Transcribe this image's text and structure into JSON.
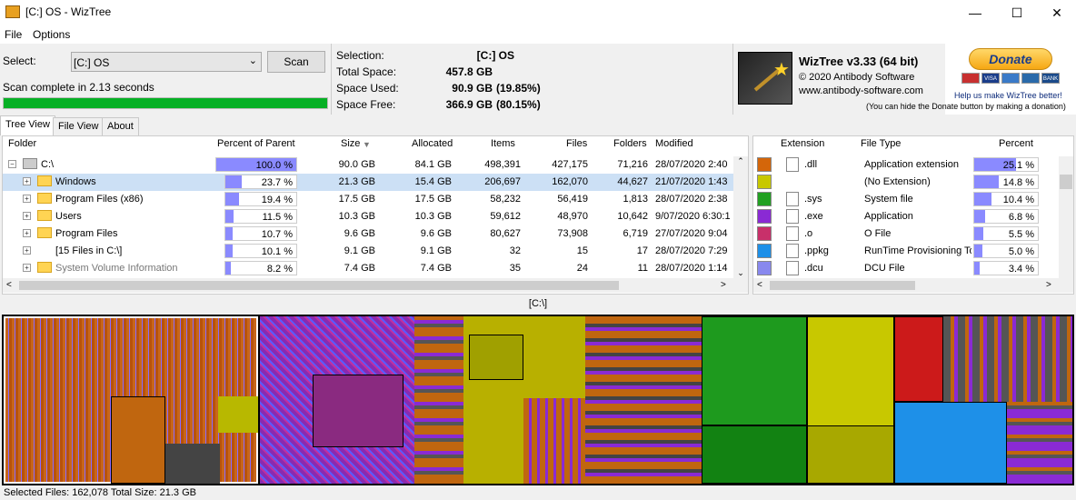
{
  "window": {
    "title": "[C:] OS  - WizTree"
  },
  "menu": [
    "File",
    "Options"
  ],
  "scan": {
    "select_label": "Select:",
    "drive_value": "[C:] OS",
    "scan_label": "Scan",
    "status": "Scan complete in 2.13 seconds",
    "progress_pct": 100
  },
  "stats": {
    "selection_label": "Selection:",
    "selection_value": "[C:]  OS",
    "total_label": "Total Space:",
    "total_value": "457.8 GB",
    "used_label": "Space Used:",
    "used_value": "90.9 GB",
    "used_pct": "(19.85%)",
    "free_label": "Space Free:",
    "free_value": "366.9 GB",
    "free_pct": "(80.15%)"
  },
  "brand": {
    "title": "WizTree v3.33 (64 bit)",
    "copyright": "© 2020 Antibody Software",
    "website": "www.antibody-software.com"
  },
  "donate": {
    "label": "Donate",
    "help_text": "Help us make WizTree better!",
    "hide_note": "(You can hide the Donate button by making a donation)",
    "cards": [
      "VISA",
      "BANK"
    ]
  },
  "tabs": [
    "Tree View",
    "File View",
    "About"
  ],
  "tree": {
    "headers": {
      "folder": "Folder",
      "percent": "Percent of Parent",
      "size": "Size",
      "allocated": "Allocated",
      "items": "Items",
      "files": "Files",
      "folders": "Folders",
      "modified": "Modified"
    },
    "rows": [
      {
        "name": "C:\\",
        "pct": 100.0,
        "pct_label": "100.0 %",
        "size": "90.0 GB",
        "allocated": "84.1 GB",
        "items": "498,391",
        "files": "427,175",
        "folders": "71,216",
        "modified": "28/07/2020 2:40"
      },
      {
        "name": "Windows",
        "pct": 23.7,
        "pct_label": "23.7 %",
        "size": "21.3 GB",
        "allocated": "15.4 GB",
        "items": "206,697",
        "files": "162,070",
        "folders": "44,627",
        "modified": "21/07/2020 1:43"
      },
      {
        "name": "Program Files (x86)",
        "pct": 19.4,
        "pct_label": "19.4 %",
        "size": "17.5 GB",
        "allocated": "17.5 GB",
        "items": "58,232",
        "files": "56,419",
        "folders": "1,813",
        "modified": "28/07/2020 2:38"
      },
      {
        "name": "Users",
        "pct": 11.5,
        "pct_label": "11.5 %",
        "size": "10.3 GB",
        "allocated": "10.3 GB",
        "items": "59,612",
        "files": "48,970",
        "folders": "10,642",
        "modified": "9/07/2020 6:30:1"
      },
      {
        "name": "Program Files",
        "pct": 10.7,
        "pct_label": "10.7 %",
        "size": "9.6 GB",
        "allocated": "9.6 GB",
        "items": "80,627",
        "files": "73,908",
        "folders": "6,719",
        "modified": "27/07/2020 9:04"
      },
      {
        "name": "[15 Files in C:\\]",
        "pct": 10.1,
        "pct_label": "10.1 %",
        "size": "9.1 GB",
        "allocated": "9.1 GB",
        "items": "32",
        "files": "15",
        "folders": "17",
        "modified": "28/07/2020 7:29"
      },
      {
        "name": "System Volume Information",
        "pct": 8.2,
        "pct_label": "8.2 %",
        "size": "7.4 GB",
        "allocated": "7.4 GB",
        "items": "35",
        "files": "24",
        "folders": "11",
        "modified": "28/07/2020 1:14"
      }
    ]
  },
  "ext": {
    "headers": {
      "extension": "Extension",
      "filetype": "File Type",
      "percent": "Percent"
    },
    "rows": [
      {
        "color": "#d4660a",
        "ext": ".dll",
        "type": "Application extension",
        "pct": 25.1,
        "pct_label": "25.1 %"
      },
      {
        "color": "#c8c800",
        "ext": "",
        "type": "(No Extension)",
        "pct": 14.8,
        "pct_label": "14.8 %"
      },
      {
        "color": "#22a022",
        "ext": ".sys",
        "type": "System file",
        "pct": 10.4,
        "pct_label": "10.4 %"
      },
      {
        "color": "#8a2ad4",
        "ext": ".exe",
        "type": "Application",
        "pct": 6.8,
        "pct_label": "6.8 %"
      },
      {
        "color": "#c8306a",
        "ext": ".o",
        "type": "O File",
        "pct": 5.5,
        "pct_label": "5.5 %"
      },
      {
        "color": "#1e90e8",
        "ext": ".ppkg",
        "type": "RunTime Provisioning To",
        "pct": 5.0,
        "pct_label": "5.0 %"
      },
      {
        "color": "#8888ee",
        "ext": ".dcu",
        "type": "DCU File",
        "pct": 3.4,
        "pct_label": "3.4 %"
      }
    ]
  },
  "treemap": {
    "path": "[C:\\]"
  },
  "status": "Selected Files: 162,078  Total Size: 21.3 GB"
}
